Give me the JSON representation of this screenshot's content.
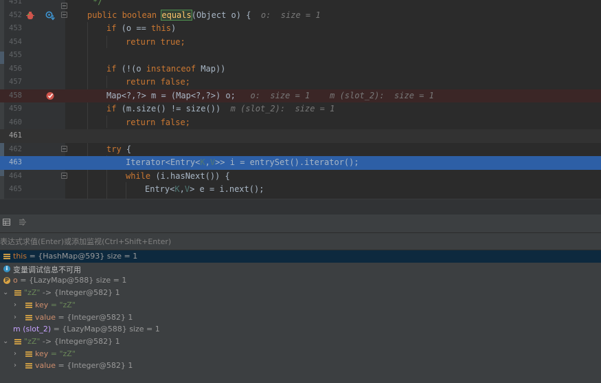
{
  "editor": {
    "lines": [
      {
        "num": "451",
        "text": "*/"
      },
      {
        "num": "452",
        "signature": {
          "kw": "public boolean ",
          "fn": "equals",
          "rest": "(Object o) {",
          "hint": "o:  size = 1"
        }
      },
      {
        "num": "453",
        "text": "if (o == this)"
      },
      {
        "num": "454",
        "text": "return true;"
      },
      {
        "num": "455",
        "text": ""
      },
      {
        "num": "456",
        "text": "if (!(o instanceof Map))"
      },
      {
        "num": "457",
        "text": "return false;"
      },
      {
        "num": "458",
        "text": "Map<?,?> m = (Map<?,?>) o;",
        "hint": "o:  size = 1    m (slot_2):  size = 1"
      },
      {
        "num": "459",
        "text": "if (m.size() != size())",
        "hint": "m (slot_2):  size = 1"
      },
      {
        "num": "460",
        "text": "return false;"
      },
      {
        "num": "461",
        "text": ""
      },
      {
        "num": "462",
        "text": "try {"
      },
      {
        "num": "463",
        "text": "Iterator<Entry<K,V>> i = entrySet().iterator();"
      },
      {
        "num": "464",
        "text": "while (i.hasNext()) {"
      },
      {
        "num": "465",
        "text": "Entry<K,V> e = i.next();"
      }
    ]
  },
  "debugger": {
    "eval_placeholder": "表达式求值(Enter)或添加监视(Ctrl+Shift+Enter)",
    "tabs": [
      "frames-icon",
      "threads-icon"
    ],
    "vars": [
      {
        "name": "this",
        "value": " = {HashMap@593}  size = 1"
      },
      {
        "info": "变量调试信息不可用"
      },
      {
        "name": "o",
        "value": " = {LazyMap@588}  size = 1"
      },
      {
        "entry": "\"zZ\"",
        "arrow": " -> {Integer@582} 1"
      },
      {
        "name": "key",
        "value": " = \"zZ\""
      },
      {
        "name": "value",
        "value": " = {Integer@582} 1"
      },
      {
        "name": "m (slot_2)",
        "value": " = {LazyMap@588}  size = 1"
      },
      {
        "entry": "\"zZ\"",
        "arrow": " -> {Integer@582} 1"
      },
      {
        "name": "key",
        "value": " = \"zZ\""
      },
      {
        "name": "value",
        "value": " = {Integer@582} 1"
      }
    ]
  },
  "colors": {
    "editor_bg": "#2b2b2b",
    "keyword": "#cc7832",
    "method": "#ffc66d",
    "execution_line": "#2d5fa6",
    "breakpoint_line": "#3b2626",
    "inline_hint": "#787878"
  }
}
